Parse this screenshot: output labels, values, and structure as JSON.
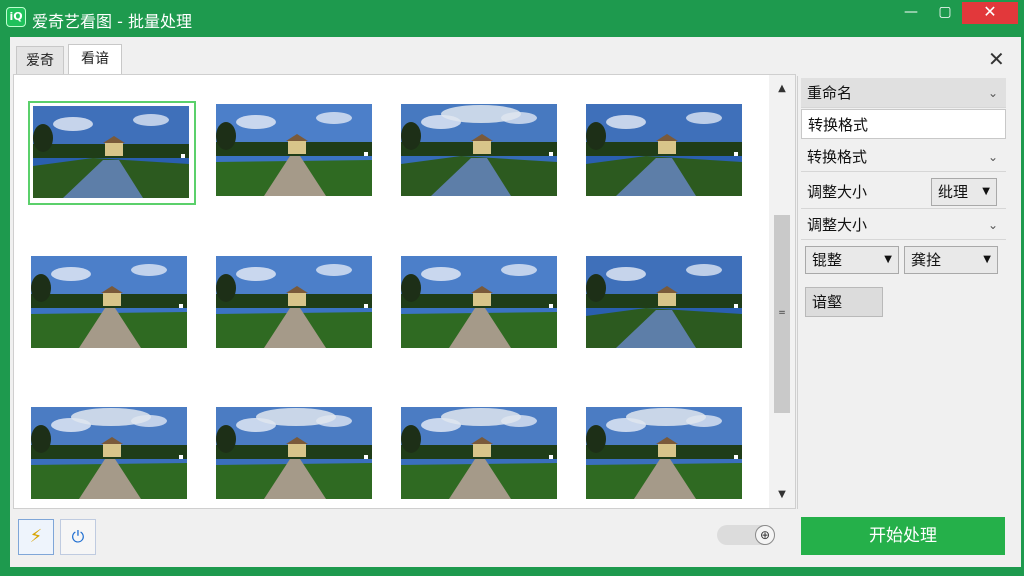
{
  "window": {
    "app_icon_text": "iQ",
    "title": "爱奇艺看图 - 批量处理",
    "min_symbol": "—",
    "max_symbol": "▢",
    "close_symbol": "✕"
  },
  "tabs": [
    {
      "label": "爱奇"
    },
    {
      "label": "看谙"
    }
  ],
  "dialog_close_symbol": "✕",
  "thumbnails": [
    {
      "variant": "canal",
      "selected": true
    },
    {
      "variant": "road",
      "selected": false
    },
    {
      "variant": "canal-cloudy",
      "selected": false
    },
    {
      "variant": "canal",
      "selected": false
    },
    {
      "variant": "road",
      "selected": false
    },
    {
      "variant": "road",
      "selected": false
    },
    {
      "variant": "road",
      "selected": false
    },
    {
      "variant": "canal",
      "selected": false
    },
    {
      "variant": "road-cloudy",
      "selected": false
    },
    {
      "variant": "road-cloudy",
      "selected": false
    },
    {
      "variant": "road-cloudy",
      "selected": false
    },
    {
      "variant": "road-cloudy",
      "selected": false
    }
  ],
  "scrollbar": {
    "up_symbol": "▲",
    "down_symbol": "▼",
    "grip_symbol": "="
  },
  "tools": {
    "flash_icon": "⚡",
    "power_icon": "⏻"
  },
  "zoom": {
    "knob_symbol": "⊕"
  },
  "panel": {
    "rename_label": "重命名",
    "convert_selected_label": "转换格式",
    "convert_label": "转换格式",
    "resize_inline_label": "调整大小",
    "resize_select_value": "纰理",
    "resize_label": "调整大小",
    "select_a_value": "锟整",
    "select_b_value": "龚拴",
    "button_label": "谙壑",
    "chevron_symbol": "⌄",
    "dropdown_symbol": "▼"
  },
  "start_button_label": "开始处理",
  "colors": {
    "accent": "#1e9a4e",
    "start": "#25b04a",
    "selection": "#5bd06b"
  }
}
